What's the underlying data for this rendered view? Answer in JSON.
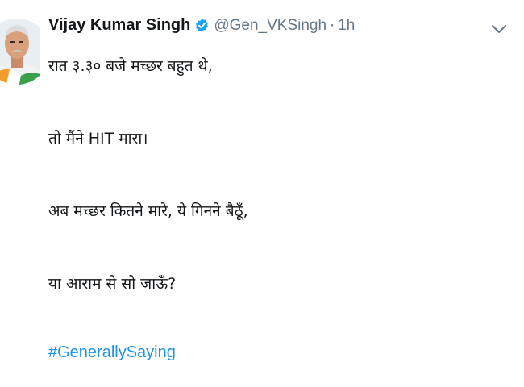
{
  "tweet": {
    "author": {
      "name": "Vijay Kumar Singh",
      "handle": "@Gen_VKSingh",
      "separator": "·",
      "time": "1h",
      "verified": true
    },
    "icons": {
      "verified": "verified-badge-icon",
      "menu": "chevron-down-icon"
    },
    "lines": [
      "रात ३.३० बजे मच्छर बहुत थे,",
      "तो मैंने HIT मारा।",
      "अब मच्छर कितने मारे, ये गिनने बैठूँ,",
      "या आराम से सो जाऊँ?"
    ],
    "hashtag": "#GenerallySaying",
    "colors": {
      "link": "#1b95e0",
      "verified": "#1da1f2",
      "secondary_text": "#657786",
      "primary_text": "#14171a"
    }
  }
}
